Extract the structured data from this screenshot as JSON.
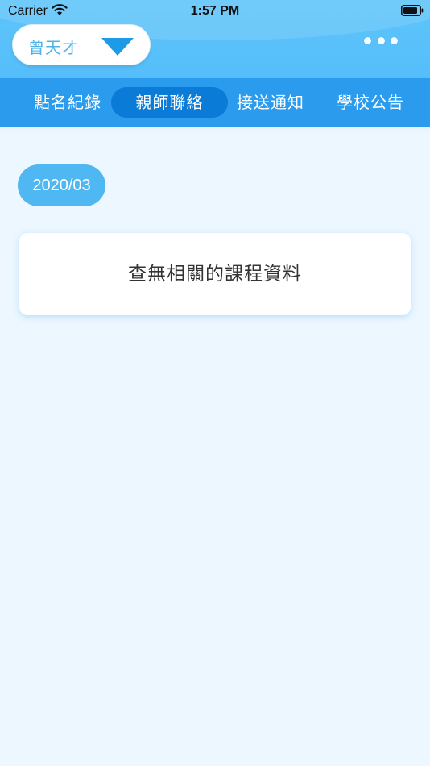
{
  "status_bar": {
    "carrier": "Carrier",
    "time": "1:57 PM"
  },
  "header": {
    "student_name": "曾天才"
  },
  "tabs": [
    {
      "label": "點名紀錄",
      "active": false
    },
    {
      "label": "親師聯絡",
      "active": true
    },
    {
      "label": "接送通知",
      "active": false
    },
    {
      "label": "學校公告",
      "active": false
    }
  ],
  "content": {
    "month": "2020/03",
    "empty_message": "查無相關的課程資料"
  },
  "icons": {
    "wifi": "wifi-icon",
    "battery": "battery-icon",
    "dropdown": "triangle-down-icon",
    "more": "more-dots-icon"
  },
  "colors": {
    "header": "#5EC4FA",
    "tab_bar": "#2B9BEE",
    "tab_active": "#0A7BD6",
    "month_pill": "#4FB8F2",
    "background": "#ECF7FF",
    "name_text": "#4FB4E8",
    "dropdown_arrow": "#1E9BE6"
  }
}
